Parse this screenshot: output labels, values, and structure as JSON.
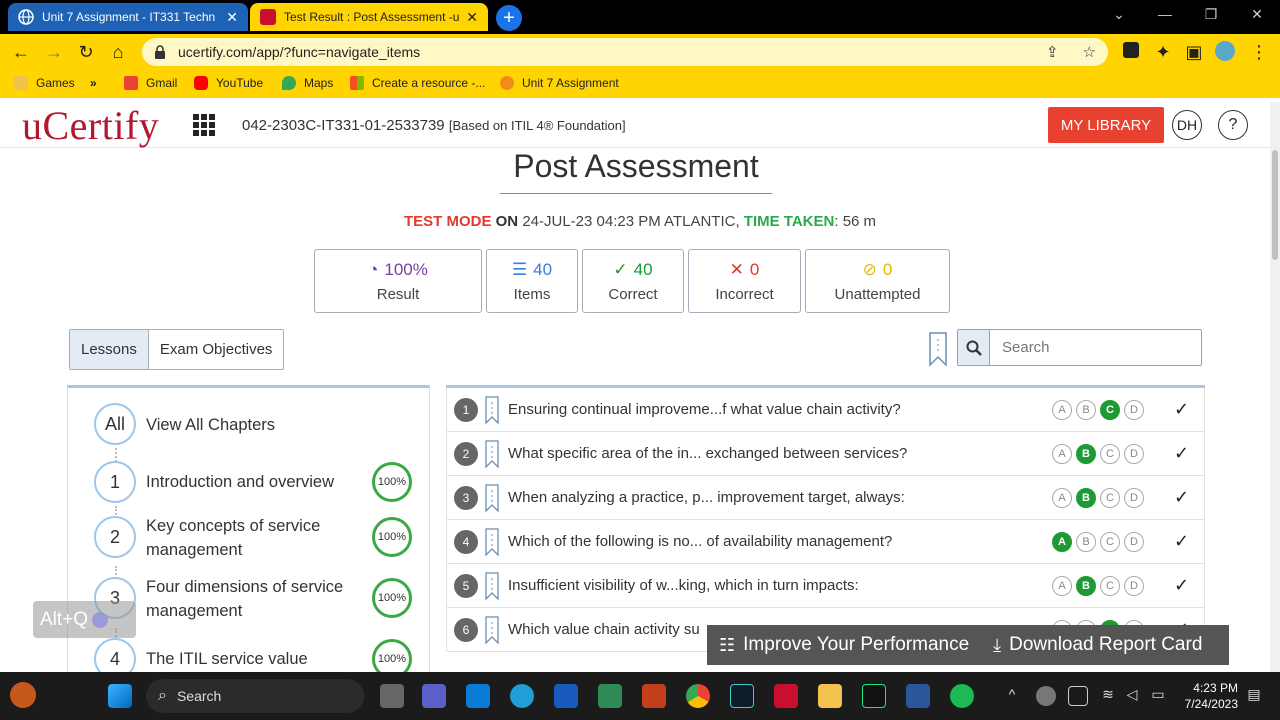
{
  "browser": {
    "tabs": [
      {
        "title": "Unit 7 Assignment - IT331 Techn",
        "active": false
      },
      {
        "title": "Test Result : Post Assessment -uC",
        "active": true
      }
    ],
    "url": "ucertify.com/app/?func=navigate_items",
    "bookmarks": [
      {
        "label": "Games",
        "icon": "folder-icon"
      },
      {
        "label": "Gmail",
        "icon": "gmail-icon"
      },
      {
        "label": "YouTube",
        "icon": "youtube-icon"
      },
      {
        "label": "Maps",
        "icon": "maps-icon"
      },
      {
        "label": "Create a resource -...",
        "icon": "microsoft-icon"
      },
      {
        "label": "Unit 7 Assignment",
        "icon": "page-icon"
      }
    ],
    "accent": "#ffd400"
  },
  "header": {
    "logo": "uCertify",
    "course_code": "042-2303C-IT331-01-2533739",
    "course_note": "[Based on ITIL 4® Foundation]",
    "library_button": "MY LIBRARY",
    "avatar": "DH",
    "help": "?"
  },
  "page": {
    "title": "Post Assessment",
    "mode_label": "TEST MODE",
    "on_label": "ON",
    "date": "24-JUL-23 04:23 PM ATLANTIC,",
    "time_label": "TIME TAKEN",
    "time_value": ": 56 m"
  },
  "stats": [
    {
      "value": "100%",
      "label": "Result",
      "color": "#7b3fa0",
      "icon": "result-icon"
    },
    {
      "value": "40",
      "label": "Items",
      "color": "#3b7dd8",
      "icon": "list-icon"
    },
    {
      "value": "40",
      "label": "Correct",
      "color": "#1e9a34",
      "icon": "check-icon"
    },
    {
      "value": "0",
      "label": "Incorrect",
      "color": "#e33a2c",
      "icon": "x-icon"
    },
    {
      "value": "0",
      "label": "Unattempted",
      "color": "#e6b800",
      "icon": "eye-slash-icon"
    }
  ],
  "filters": {
    "tabs": [
      "Lessons",
      "Exam Objectives"
    ],
    "search_placeholder": "Search"
  },
  "chapters": [
    {
      "num": "All",
      "name": "View All Chapters",
      "pct": ""
    },
    {
      "num": "1",
      "name": "Introduction and overview",
      "pct": "100%"
    },
    {
      "num": "2",
      "name": "Key concepts of service management",
      "pct": "100%"
    },
    {
      "num": "3",
      "name": "Four dimensions of service management",
      "pct": "100%"
    },
    {
      "num": "4",
      "name": "The ITIL service value system",
      "pct": "100%"
    }
  ],
  "questions": [
    {
      "num": "1",
      "text": "Ensuring continual improveme...f what value chain activity?",
      "answer": "C"
    },
    {
      "num": "2",
      "text": "What specific area of the in... exchanged between services?",
      "answer": "B"
    },
    {
      "num": "3",
      "text": "When analyzing a practice, p... improvement target, always:",
      "answer": "B"
    },
    {
      "num": "4",
      "text": "Which of the following is no... of availability management?",
      "answer": "A"
    },
    {
      "num": "5",
      "text": "Insufficient visibility of w...king, which in turn impacts:",
      "answer": "B"
    },
    {
      "num": "6",
      "text": "Which value chain activity su",
      "answer": "C"
    }
  ],
  "options": [
    "A",
    "B",
    "C",
    "D"
  ],
  "actions": {
    "improve": "Improve Your Performance",
    "download": "Download Report Card"
  },
  "overlay": {
    "altq": "Alt+Q"
  },
  "taskbar": {
    "search": "Search",
    "time": "4:23 PM",
    "date": "7/24/2023"
  }
}
